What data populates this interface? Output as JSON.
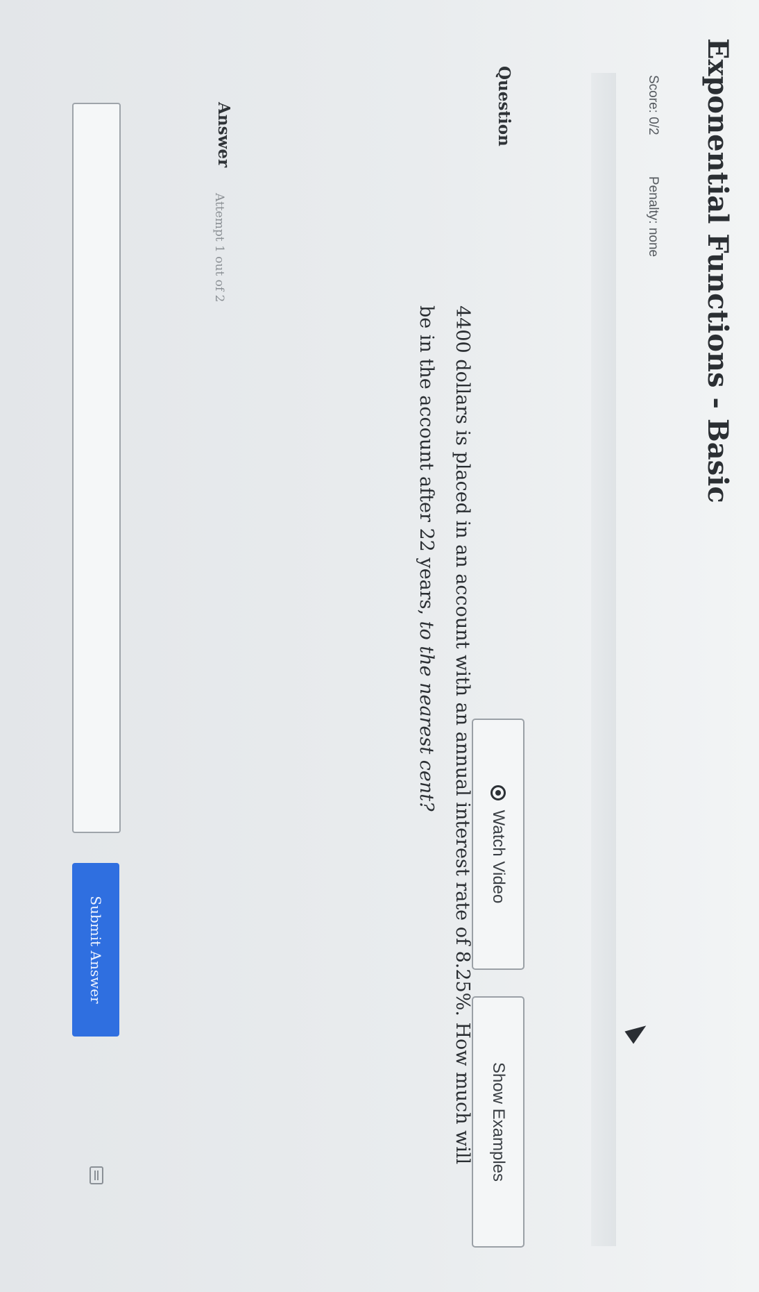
{
  "header": {
    "title": "Exponential Functions - Basic",
    "score": "Score: 0/2",
    "penalty": "Penalty: none"
  },
  "question": {
    "label": "Question",
    "watch_video": "Watch Video",
    "show_examples": "Show Examples",
    "text_main": "4400 dollars is placed in an account with an annual interest rate of 8.25%. How much will be in the account after 22 years, ",
    "text_emphasis": "to the nearest cent?"
  },
  "answer": {
    "label": "Answer",
    "attempt": "Attempt 1 out of 2",
    "value": "",
    "submit": "Submit Answer"
  },
  "icons": {
    "video": "play-circle-icon",
    "keypad": "keyboard-icon",
    "cursor": "mouse-pointer-icon"
  }
}
